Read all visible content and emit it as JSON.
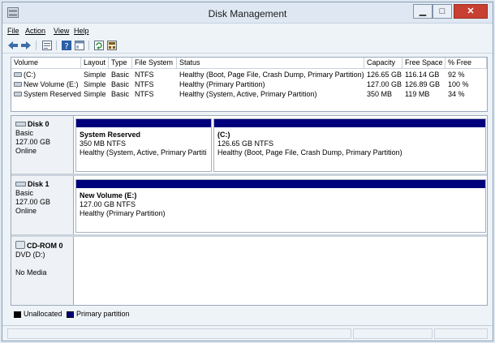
{
  "window": {
    "title": "Disk Management"
  },
  "menu": [
    {
      "label": "File",
      "key": "F"
    },
    {
      "label": "Action",
      "key": "A"
    },
    {
      "label": "View",
      "key": "V"
    },
    {
      "label": "Help",
      "key": "H"
    }
  ],
  "toolbar": {
    "icons": [
      "back-arrow-icon",
      "forward-arrow-icon",
      "properties-icon",
      "help-icon",
      "console-icon",
      "refresh-icon",
      "settings-icon"
    ]
  },
  "volume_list": {
    "columns": [
      "Volume",
      "Layout",
      "Type",
      "File System",
      "Status",
      "Capacity",
      "Free Space",
      "% Free"
    ],
    "rows": [
      [
        "(C:)",
        "Simple",
        "Basic",
        "NTFS",
        "Healthy (Boot, Page File, Crash Dump, Primary Partition)",
        "126.65 GB",
        "116.14 GB",
        "92 %"
      ],
      [
        "New Volume (E:)",
        "Simple",
        "Basic",
        "NTFS",
        "Healthy (Primary Partition)",
        "127.00 GB",
        "126.89 GB",
        "100 %"
      ],
      [
        "System Reserved",
        "Simple",
        "Basic",
        "NTFS",
        "Healthy (System, Active, Primary Partition)",
        "350 MB",
        "119 MB",
        "34 %"
      ]
    ]
  },
  "disks": [
    {
      "name": "Disk 0",
      "type": "Basic",
      "size": "127.00 GB",
      "state": "Online",
      "partitions": [
        {
          "name": "System Reserved",
          "size": "350 MB NTFS",
          "status": "Healthy (System, Active, Primary Partiti"
        },
        {
          "name": "(C:)",
          "size": "126.65 GB NTFS",
          "status": "Healthy (Boot, Page File, Crash Dump, Primary Partition)"
        }
      ]
    },
    {
      "name": "Disk 1",
      "type": "Basic",
      "size": "127.00 GB",
      "state": "Online",
      "partitions": [
        {
          "name": "New Volume  (E:)",
          "size": "127.00 GB NTFS",
          "status": "Healthy (Primary Partition)"
        }
      ]
    },
    {
      "name": "CD-ROM 0",
      "type": "DVD (D:)",
      "size": "",
      "state": "No Media",
      "partitions": []
    }
  ],
  "legend": [
    {
      "label": "Unallocated",
      "color": "#000000"
    },
    {
      "label": "Primary partition",
      "color": "#00007d"
    }
  ],
  "colors": {
    "primary_partition": "#00007d",
    "close_button": "#c84031"
  }
}
